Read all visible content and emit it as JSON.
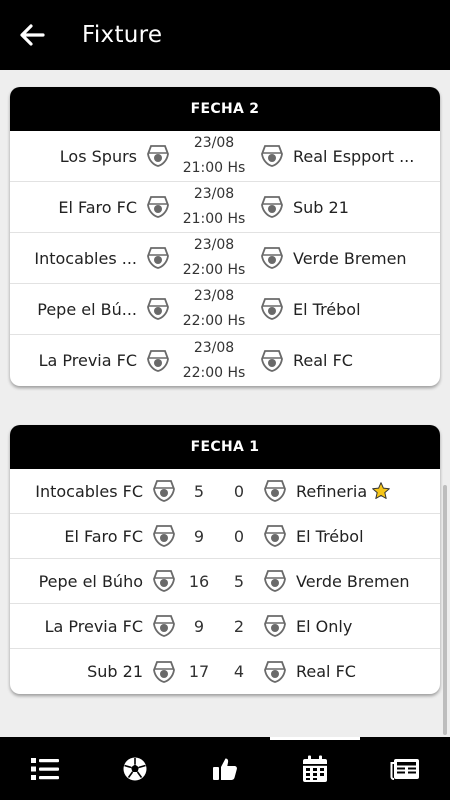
{
  "appbar": {
    "title": "Fixture",
    "back_icon": "arrow-left-icon"
  },
  "rounds": [
    {
      "title": "FECHA 2",
      "matches": [
        {
          "home": "Los Spurs",
          "date": "23/08",
          "time": "21:00 Hs",
          "away": "Real Espport ..."
        },
        {
          "home": "El Faro FC",
          "date": "23/08",
          "time": "21:00 Hs",
          "away": "Sub 21"
        },
        {
          "home": "Intocables ...",
          "date": "23/08",
          "time": "22:00 Hs",
          "away": "Verde Bremen"
        },
        {
          "home": "Pepe el Bú...",
          "date": "23/08",
          "time": "22:00 Hs",
          "away": "El Trébol"
        },
        {
          "home": "La Previa FC",
          "date": "23/08",
          "time": "22:00 Hs",
          "away": "Real FC"
        }
      ]
    },
    {
      "title": "FECHA 1",
      "matches": [
        {
          "home": "Intocables FC",
          "home_score": "5",
          "away_score": "0",
          "away": "Refineria",
          "star": true
        },
        {
          "home": "El Faro FC",
          "home_score": "9",
          "away_score": "0",
          "away": "El Trébol"
        },
        {
          "home": "Pepe el Búho",
          "home_score": "16",
          "away_score": "5",
          "away": "Verde Bremen"
        },
        {
          "home": "La Previa FC",
          "home_score": "9",
          "away_score": "2",
          "away": "El Only"
        },
        {
          "home": "Sub 21",
          "home_score": "17",
          "away_score": "4",
          "away": "Real FC"
        }
      ]
    }
  ],
  "bottom_nav": [
    {
      "name": "standings",
      "icon": "list-numbered-icon",
      "active": false
    },
    {
      "name": "teams",
      "icon": "soccer-ball-icon",
      "active": false
    },
    {
      "name": "likes",
      "icon": "thumbs-up-icon",
      "active": false
    },
    {
      "name": "fixture",
      "icon": "calendar-icon",
      "active": true
    },
    {
      "name": "news",
      "icon": "newspaper-icon",
      "active": false
    }
  ],
  "colors": {
    "appbar": "#000000",
    "background": "#eeeeee",
    "star": "#f5c518"
  }
}
